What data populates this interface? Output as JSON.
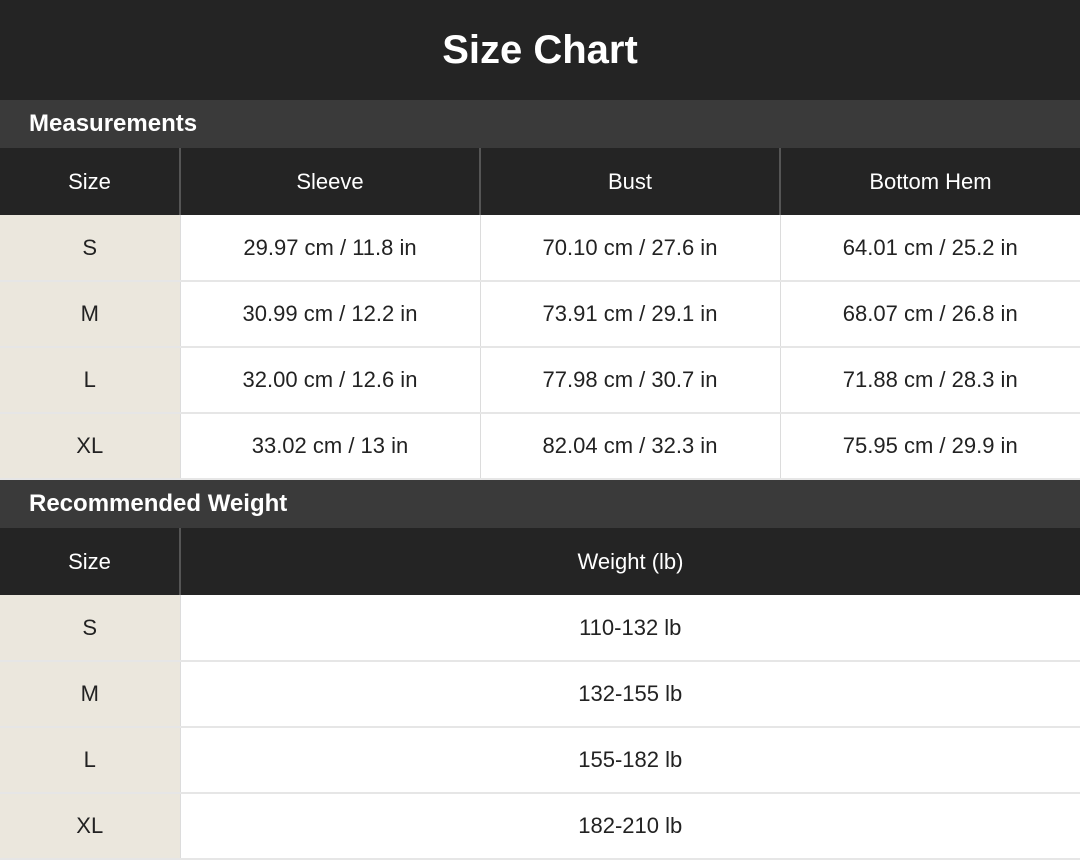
{
  "title": "Size Chart",
  "measurements": {
    "heading": "Measurements",
    "columns": [
      "Size",
      "Sleeve",
      "Bust",
      "Bottom Hem"
    ],
    "rows": [
      [
        "S",
        "29.97 cm / 11.8 in",
        "70.10 cm / 27.6 in",
        "64.01 cm / 25.2 in"
      ],
      [
        "M",
        "30.99 cm / 12.2 in",
        "73.91 cm / 29.1 in",
        "68.07 cm / 26.8 in"
      ],
      [
        "L",
        "32.00 cm / 12.6 in",
        "77.98 cm / 30.7 in",
        "71.88 cm / 28.3 in"
      ],
      [
        "XL",
        "33.02 cm / 13 in",
        "82.04 cm / 32.3 in",
        "75.95 cm / 29.9 in"
      ]
    ]
  },
  "weight": {
    "heading": "Recommended Weight",
    "columns": [
      "Size",
      "Weight (lb)"
    ],
    "rows": [
      [
        "S",
        "110-132 lb"
      ],
      [
        "M",
        "132-155 lb"
      ],
      [
        "L",
        "155-182 lb"
      ],
      [
        "XL",
        "182-210 lb"
      ]
    ]
  },
  "colors": {
    "header_bg": "#242424",
    "section_bg": "#3a3a3a",
    "size_column_bg": "#ebe7dd"
  }
}
